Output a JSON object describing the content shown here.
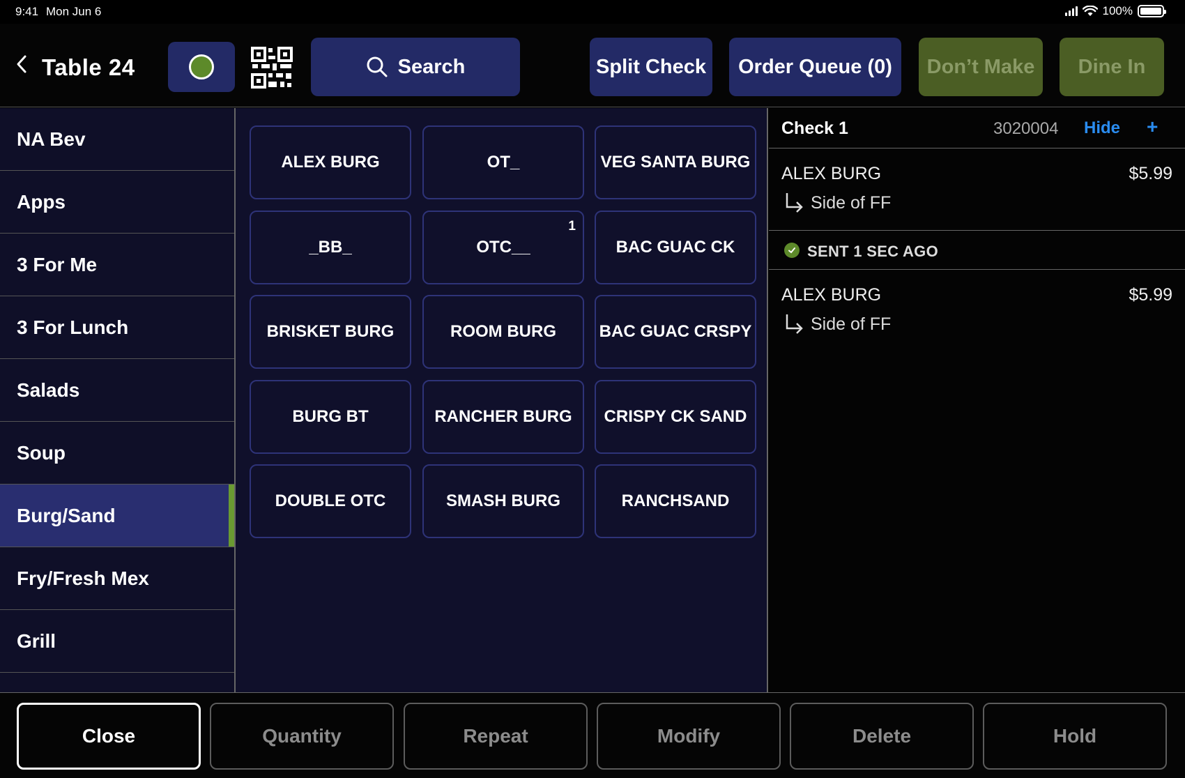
{
  "status_bar": {
    "time": "9:41",
    "date": "Mon Jun 6",
    "battery": "100%",
    "battery_level": 1.0
  },
  "header": {
    "table_title": "Table 24",
    "status_color": "#5d8a2a",
    "search_label": "Search",
    "split_check_label": "Split Check",
    "order_queue_label": "Order Queue (0)",
    "dont_make_label": "Don’t Make",
    "dine_in_label": "Dine In"
  },
  "categories": [
    {
      "label": "NA Bev"
    },
    {
      "label": "Apps"
    },
    {
      "label": "3 For Me"
    },
    {
      "label": "3 For Lunch"
    },
    {
      "label": "Salads"
    },
    {
      "label": "Soup"
    },
    {
      "label": "Burg/Sand",
      "active": true
    },
    {
      "label": "Fry/Fresh Mex"
    },
    {
      "label": "Grill"
    }
  ],
  "menu_items": [
    {
      "label": "ALEX BURG"
    },
    {
      "label": "OT_"
    },
    {
      "label": "VEG SANTA BURG"
    },
    {
      "label": "_BB_"
    },
    {
      "label": "OTC__",
      "badge": "1"
    },
    {
      "label": "BAC GUAC CK"
    },
    {
      "label": "BRISKET BURG"
    },
    {
      "label": "ROOM BURG"
    },
    {
      "label": "BAC GUAC CRSPY"
    },
    {
      "label": "BURG BT"
    },
    {
      "label": "RANCHER BURG"
    },
    {
      "label": "CRISPY CK SAND"
    },
    {
      "label": "DOUBLE OTC"
    },
    {
      "label": "SMASH BURG"
    },
    {
      "label": "RANCHSAND"
    }
  ],
  "check": {
    "title": "Check 1",
    "number": "3020004",
    "hide_label": "Hide",
    "add_label": "+",
    "unsent": [
      {
        "name": "ALEX BURG",
        "price": "$5.99",
        "modifier": "Side of FF"
      }
    ],
    "sent_label": "SENT 1 SEC AGO",
    "sent": [
      {
        "name": "ALEX BURG",
        "price": "$5.99",
        "modifier": "Side of FF"
      }
    ]
  },
  "footer": {
    "close_label": "Close",
    "quantity_label": "Quantity",
    "repeat_label": "Repeat",
    "modify_label": "Modify",
    "delete_label": "Delete",
    "hold_label": "Hold"
  },
  "colors": {
    "accent_blue": "#232a66",
    "accent_green": "#5d8a2a",
    "link_blue": "#2a8cf0"
  }
}
